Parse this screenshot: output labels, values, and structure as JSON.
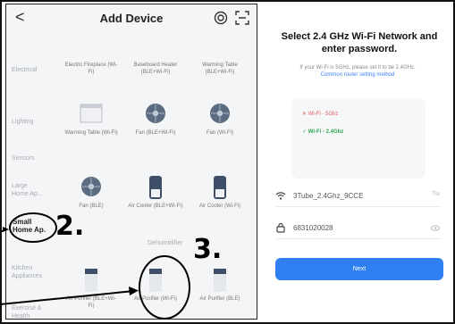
{
  "header": {
    "title": "Add Device",
    "back": "<"
  },
  "sidebar": [
    {
      "label": "Electrical"
    },
    {
      "label": "Lighting"
    },
    {
      "label": "Sensors"
    },
    {
      "label": "Large Home Ap..."
    },
    {
      "label": "Small Home Ap."
    },
    {
      "label": "Kitchen Appliances"
    },
    {
      "label": "Exercise & Health"
    }
  ],
  "devices": [
    {
      "name": "Electric Fireplace (Wi-Fi)"
    },
    {
      "name": "Baseboard Heater (BLE+Wi-Fi)"
    },
    {
      "name": "Warming Table (BLE+Wi-Fi)"
    },
    {
      "name": "Warming Table (Wi-Fi)"
    },
    {
      "name": "Fan (BLE+Wi-Fi)"
    },
    {
      "name": "Fan (Wi-Fi)"
    },
    {
      "name": "Fan (BLE)"
    },
    {
      "name": "Air Cooler (BLE+Wi-Fi)"
    },
    {
      "name": "Air Cooler (Wi-Fi)"
    },
    {
      "name": "Air Purifier (BLE+Wi-Fi)"
    },
    {
      "name": "Air Purifier (Wi-Fi)"
    },
    {
      "name": "Air Purifier (BLE)"
    }
  ],
  "section_label": "Dehumidifier",
  "wifi": {
    "title": "Select 2.4 GHz Wi-Fi Network and enter password.",
    "subtitle": "If your Wi-Fi is 5GHz, please set it to be 2.4GHz.",
    "link": "Common router setting method",
    "network_5g": "Wi-Fi - 5Ghz",
    "network_24": "Wi-Fi - 2.4Ghz",
    "ssid": "3Tube_2.4Ghz_9CCE",
    "password": "6831020028",
    "ssid_action": "Tw",
    "next_label": "Next"
  },
  "annotations": {
    "step2": "2.",
    "step3": "3."
  },
  "colors": {
    "accent": "#2f7ff0",
    "link": "#3b82f6",
    "selected_text": "#222222"
  }
}
